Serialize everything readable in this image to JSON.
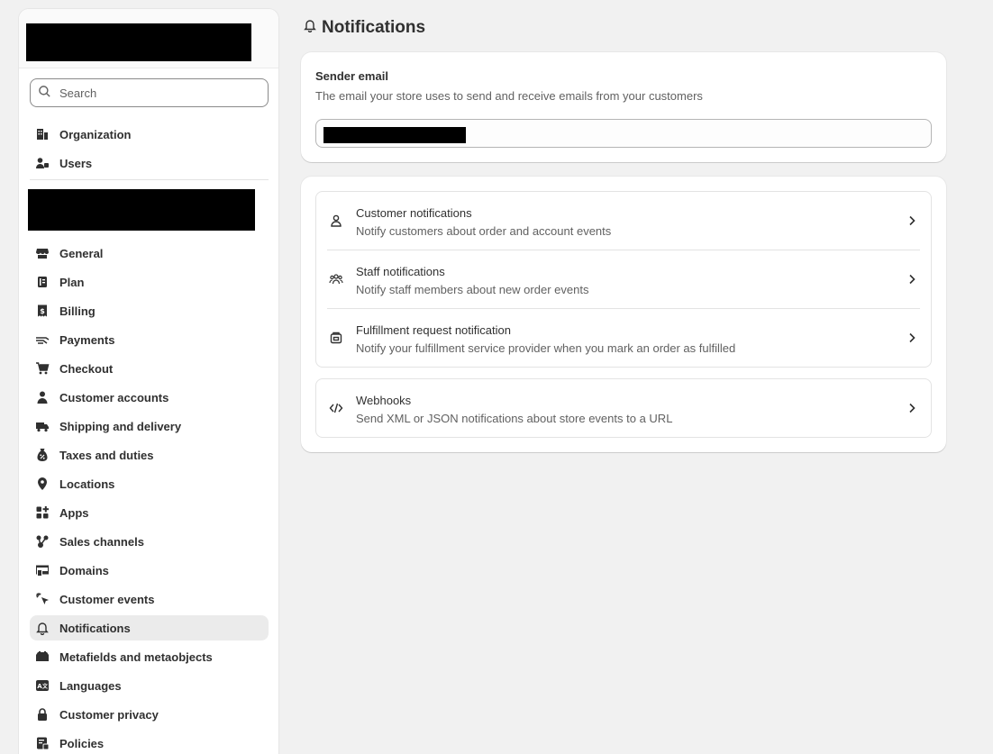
{
  "sidebar": {
    "search_placeholder": "Search",
    "account_items": [
      {
        "label": "Organization",
        "icon": "organization-icon"
      },
      {
        "label": "Users",
        "icon": "users-icon"
      }
    ],
    "store_items": [
      {
        "label": "General",
        "icon": "store-icon"
      },
      {
        "label": "Plan",
        "icon": "plan-icon"
      },
      {
        "label": "Billing",
        "icon": "billing-icon"
      },
      {
        "label": "Payments",
        "icon": "payments-icon"
      },
      {
        "label": "Checkout",
        "icon": "cart-icon"
      },
      {
        "label": "Customer accounts",
        "icon": "person-icon"
      },
      {
        "label": "Shipping and delivery",
        "icon": "truck-icon"
      },
      {
        "label": "Taxes and duties",
        "icon": "tax-icon"
      },
      {
        "label": "Locations",
        "icon": "location-pin-icon"
      },
      {
        "label": "Apps",
        "icon": "apps-icon"
      },
      {
        "label": "Sales channels",
        "icon": "sales-channels-icon"
      },
      {
        "label": "Domains",
        "icon": "domains-icon"
      },
      {
        "label": "Customer events",
        "icon": "cursor-click-icon"
      },
      {
        "label": "Notifications",
        "icon": "bell-icon",
        "active": true
      },
      {
        "label": "Metafields and metaobjects",
        "icon": "metafields-icon"
      },
      {
        "label": "Languages",
        "icon": "language-icon"
      },
      {
        "label": "Customer privacy",
        "icon": "lock-icon"
      },
      {
        "label": "Policies",
        "icon": "policies-icon"
      }
    ]
  },
  "main": {
    "title": "Notifications",
    "sender": {
      "title": "Sender email",
      "description": "The email your store uses to send and receive emails from your customers"
    },
    "groups": [
      [
        {
          "title": "Customer notifications",
          "description": "Notify customers about order and account events",
          "icon": "person-outline-icon"
        },
        {
          "title": "Staff notifications",
          "description": "Notify staff members about new order events",
          "icon": "team-icon"
        },
        {
          "title": "Fulfillment request notification",
          "description": "Notify your fulfillment service provider when you mark an order as fulfilled",
          "icon": "fulfillment-icon"
        }
      ],
      [
        {
          "title": "Webhooks",
          "description": "Send XML or JSON notifications about store events to a URL",
          "icon": "code-icon"
        }
      ]
    ]
  },
  "colors": {
    "background": "#f1f1f1",
    "surface": "#ffffff",
    "text": "#303030",
    "text_subdued": "#616161",
    "active_nav": "#ebebeb"
  }
}
